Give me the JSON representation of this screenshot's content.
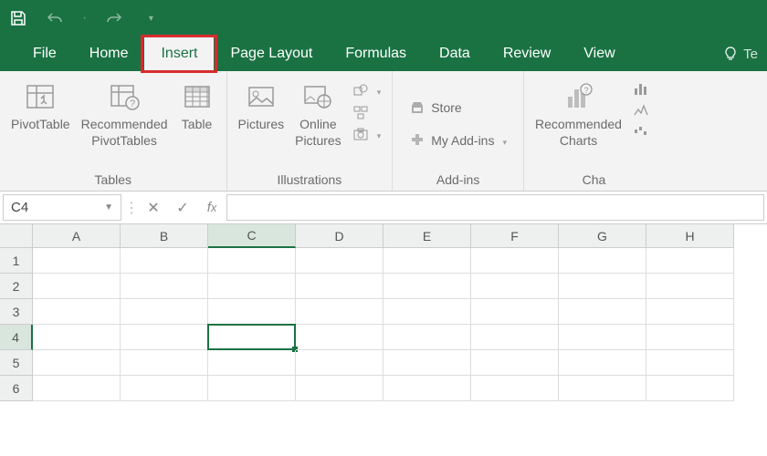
{
  "qat": {
    "save": "save-icon",
    "undo": "undo-icon",
    "redo": "redo-icon"
  },
  "tabs": {
    "file": "File",
    "home": "Home",
    "insert": "Insert",
    "pagelayout": "Page Layout",
    "formulas": "Formulas",
    "data": "Data",
    "review": "Review",
    "view": "View",
    "tellme": "Te"
  },
  "active_tab": "Insert",
  "ribbon": {
    "tables": {
      "label": "Tables",
      "pivottable": "PivotTable",
      "recommended_pt": "Recommended\nPivotTables",
      "table": "Table"
    },
    "illustrations": {
      "label": "Illustrations",
      "pictures": "Pictures",
      "online_pictures": "Online\nPictures"
    },
    "addins": {
      "label": "Add-ins",
      "store": "Store",
      "myaddins": "My Add-ins"
    },
    "charts": {
      "label": "Cha",
      "recommended_charts": "Recommended\nCharts"
    }
  },
  "namebox": "C4",
  "formula": "",
  "columns": [
    "A",
    "B",
    "C",
    "D",
    "E",
    "F",
    "G",
    "H"
  ],
  "rows": [
    "1",
    "2",
    "3",
    "4",
    "5",
    "6"
  ],
  "active_cell": {
    "col": "C",
    "row": "4"
  }
}
